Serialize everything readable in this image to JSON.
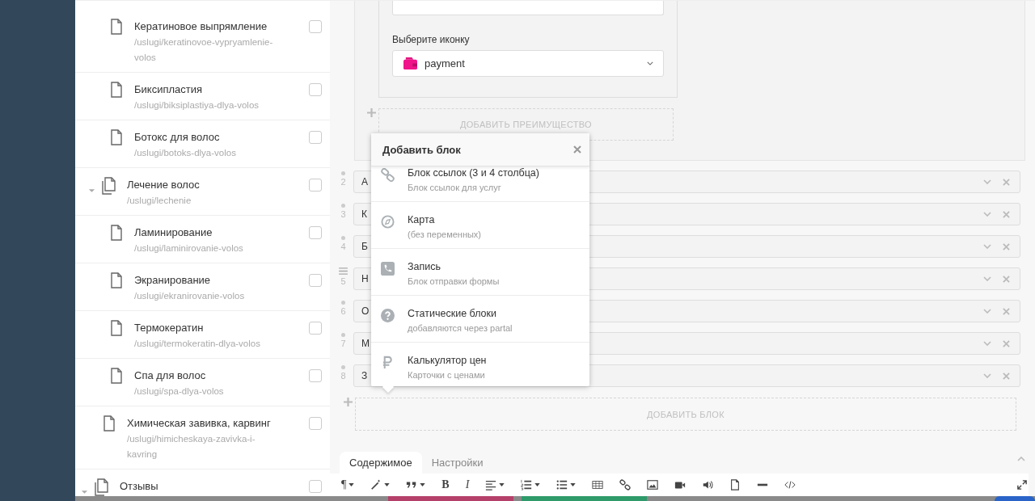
{
  "sidebar": {
    "tree": [
      {
        "children": [
          {
            "children": [
              {
                "kind": "page",
                "title": "Кератиновое выпрямление",
                "path": "/uslugi/keratinovoe-vypryamlenie-volos",
                "checked": false
              },
              {
                "kind": "page",
                "title": "Биксипластия",
                "path": "/uslugi/biksiplastiya-dlya-volos",
                "checked": false
              },
              {
                "kind": "page",
                "title": "Ботокс для волос",
                "path": "/uslugi/botoks-dlya-volos",
                "checked": false
              }
            ]
          },
          {
            "kind": "section",
            "title": "Лечение волос",
            "path": "/uslugi/lechenie",
            "checked": false,
            "expanded": true,
            "children": [
              {
                "kind": "page",
                "title": "Ламинирование",
                "path": "/uslugi/laminirovanie-volos",
                "checked": false
              },
              {
                "kind": "page",
                "title": "Экранирование",
                "path": "/uslugi/ekranirovanie-volos",
                "checked": false
              },
              {
                "kind": "page",
                "title": "Термокератин",
                "path": "/uslugi/termokeratin-dlya-volos",
                "checked": false
              },
              {
                "kind": "page",
                "title": "Спа для волос",
                "path": "/uslugi/spa-dlya-volos",
                "checked": false
              }
            ]
          },
          {
            "kind": "page",
            "title": "Химическая завивка, карвинг",
            "path": "/uslugi/himicheskaya-zavivka-i-kavring",
            "checked": false
          }
        ]
      },
      {
        "kind": "section",
        "title": "Отзывы",
        "checked": false,
        "expanded": true
      }
    ]
  },
  "editor": {
    "advantage": {
      "icon_label": "Выберите иконку",
      "icon_value": "payment",
      "add_button": "ДОБАВИТЬ ПРЕИМУЩЕСТВО"
    },
    "blocks": [
      {
        "number": "2",
        "text": "А",
        "kind": "dot"
      },
      {
        "number": "3",
        "text": "К",
        "kind": "dot"
      },
      {
        "number": "4",
        "text": "Б",
        "kind": "dot"
      },
      {
        "number": "5",
        "text": "Н",
        "kind": "grip"
      },
      {
        "number": "6",
        "text": "О",
        "kind": "dot"
      },
      {
        "number": "7",
        "text": "М",
        "kind": "dot"
      },
      {
        "number": "8",
        "text": "З",
        "kind": "dot"
      }
    ],
    "add_block_button": "ДОБАВИТЬ БЛОК",
    "popup": {
      "title": "Добавить блок",
      "items": [
        {
          "kind": "link",
          "title": "Блок ссылок (3 и 4 столбца)",
          "subtitle": "Блок ссылок для услуг"
        },
        {
          "kind": "map",
          "title": "Карта",
          "subtitle": "(без переменных)"
        },
        {
          "kind": "phone",
          "title": "Запись",
          "subtitle": "Блок отправки формы"
        },
        {
          "kind": "question",
          "title": "Статические блоки",
          "subtitle": "добавляются через partal"
        },
        {
          "kind": "ruble",
          "title": "Калькулятор цен",
          "subtitle": "Карточки с ценами"
        }
      ]
    },
    "tabs": [
      {
        "label": "Содержимое",
        "selected": true
      },
      {
        "label": "Настройки",
        "selected": false
      }
    ],
    "toolbar": [
      {
        "kind": "paragraph",
        "label": "¶",
        "caret": true
      },
      {
        "kind": "wand",
        "caret": true
      },
      {
        "kind": "quote",
        "caret": true
      },
      {
        "kind": "bold",
        "label": "B",
        "caret": false
      },
      {
        "kind": "italic",
        "label": "I",
        "caret": false
      },
      {
        "kind": "align",
        "caret": true
      },
      {
        "kind": "ol",
        "caret": true
      },
      {
        "kind": "ul",
        "caret": true
      },
      {
        "kind": "table",
        "caret": false
      },
      {
        "kind": "link",
        "caret": false
      },
      {
        "kind": "image",
        "caret": false
      },
      {
        "kind": "video",
        "caret": false
      },
      {
        "kind": "audio",
        "caret": false
      },
      {
        "kind": "file",
        "caret": false
      },
      {
        "kind": "hr",
        "caret": false
      },
      {
        "kind": "code",
        "caret": false
      }
    ]
  }
}
